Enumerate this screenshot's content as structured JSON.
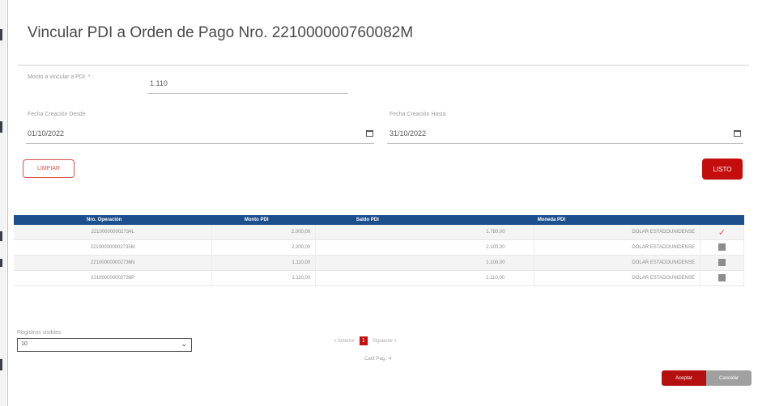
{
  "dialog": {
    "title": "Vincular PDI a Orden de Pago Nro. 221000000760082M"
  },
  "form": {
    "monto_label": "Monto a vincular a PDI: *",
    "monto_value": "1.110",
    "fecha_desde_label": "Fecha Creación Desde",
    "fecha_desde_value": "01/10/2022",
    "fecha_hasta_label": "Fecha Creación Hasta",
    "fecha_hasta_value": "31/10/2022",
    "limpiar_label": "LIMPIAR",
    "listo_label": "LISTO"
  },
  "table": {
    "headers": [
      "Nro. Operación",
      "Monto PDI",
      "Saldo PDI",
      "Moneda PDI"
    ],
    "rows": [
      {
        "nro": "221000000002734L",
        "monto": "2.000,00",
        "saldo": "1.780,00",
        "moneda": "DOLAR ESTADOUNIDENSE",
        "selected": true
      },
      {
        "nro": "221000000002735M",
        "monto": "2.200,00",
        "saldo": "2.100,00",
        "moneda": "DOLAR ESTADOUNIDENSE",
        "selected": false
      },
      {
        "nro": "221000000002736N",
        "monto": "1.110,00",
        "saldo": "1.100,00",
        "moneda": "DOLAR ESTADOUNIDENSE",
        "selected": false
      },
      {
        "nro": "221000000002738P",
        "monto": "1.110,00",
        "saldo": "1.110,00",
        "moneda": "DOLAR ESTADOUNIDENSE",
        "selected": false
      }
    ]
  },
  "pagination": {
    "rows_label": "Registros visibles",
    "rows_value": "10",
    "prev_label": "< Anterior",
    "current_page": "1",
    "next_label": "Siguiente >",
    "page_count": "Cant Pag.: 4"
  },
  "footer": {
    "aceptar_label": "Aceptar",
    "cancelar_label": "Cancelar"
  },
  "colors": {
    "primary_red": "#c40d0d",
    "header_blue": "#1d4f8c"
  }
}
